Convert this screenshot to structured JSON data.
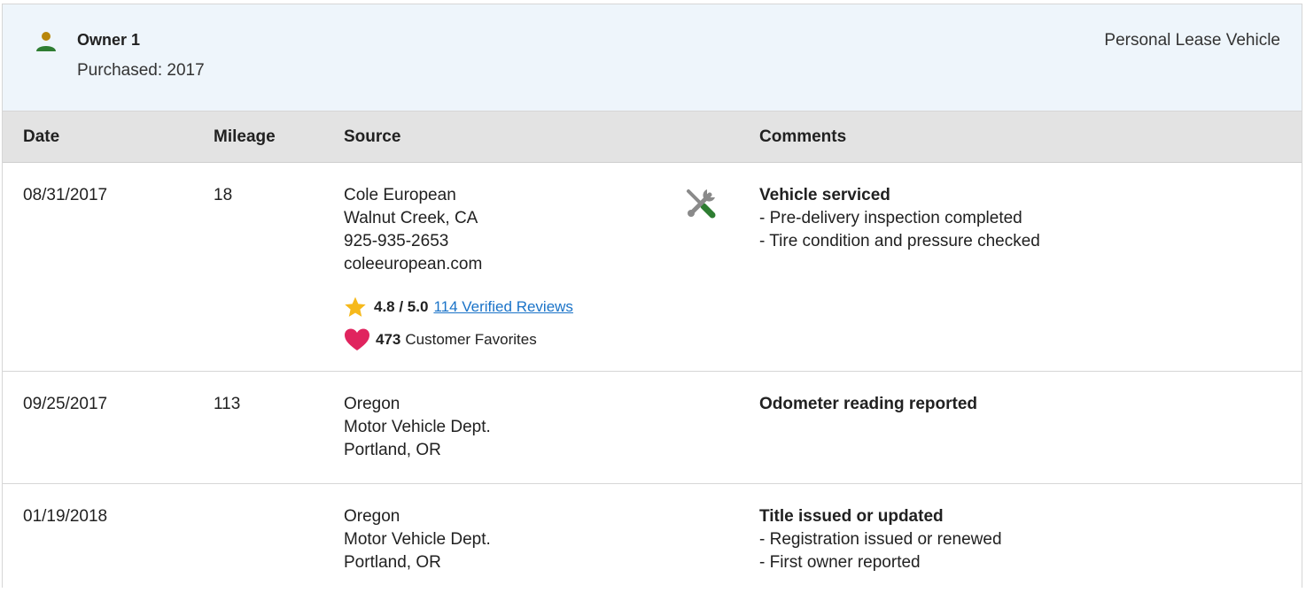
{
  "owner": {
    "title": "Owner 1",
    "purchased": "Purchased: 2017",
    "vehicle_type": "Personal Lease Vehicle"
  },
  "table": {
    "headers": {
      "date": "Date",
      "mileage": "Mileage",
      "source": "Source",
      "comments": "Comments"
    },
    "rows": [
      {
        "date": "08/31/2017",
        "mileage": "18",
        "source": [
          "Cole European",
          "Walnut Creek, CA",
          "925-935-2653",
          "coleeuropean.com"
        ],
        "rating": "4.8 / 5.0",
        "reviews_link": "114 Verified Reviews",
        "favorites_count": "473",
        "favorites_label": "Customer Favorites",
        "comment_title": "Vehicle serviced",
        "comment_items": [
          "- Pre-delivery inspection completed",
          "- Tire condition and pressure checked"
        ]
      },
      {
        "date": "09/25/2017",
        "mileage": "113",
        "source": [
          "Oregon",
          "Motor Vehicle Dept.",
          "Portland, OR"
        ],
        "comment_title": "Odometer reading reported"
      },
      {
        "date": "01/19/2018",
        "mileage": "",
        "source": [
          "Oregon",
          "Motor Vehicle Dept.",
          "Portland, OR"
        ],
        "comment_title": "Title issued or updated",
        "comment_items": [
          "- Registration issued or renewed",
          "- First owner reported"
        ]
      }
    ]
  },
  "icons": {
    "owner": "person-icon",
    "service": "wrench-screwdriver-icon",
    "rating": "star-icon",
    "favorites": "heart-icon"
  },
  "colors": {
    "header_bg": "#eef5fb",
    "table_header_bg": "#e3e3e3",
    "link": "#1a73c8",
    "star": "#f6b91b",
    "heart": "#e0245e",
    "person_head": "#b8860b",
    "person_body": "#2e7d32"
  }
}
